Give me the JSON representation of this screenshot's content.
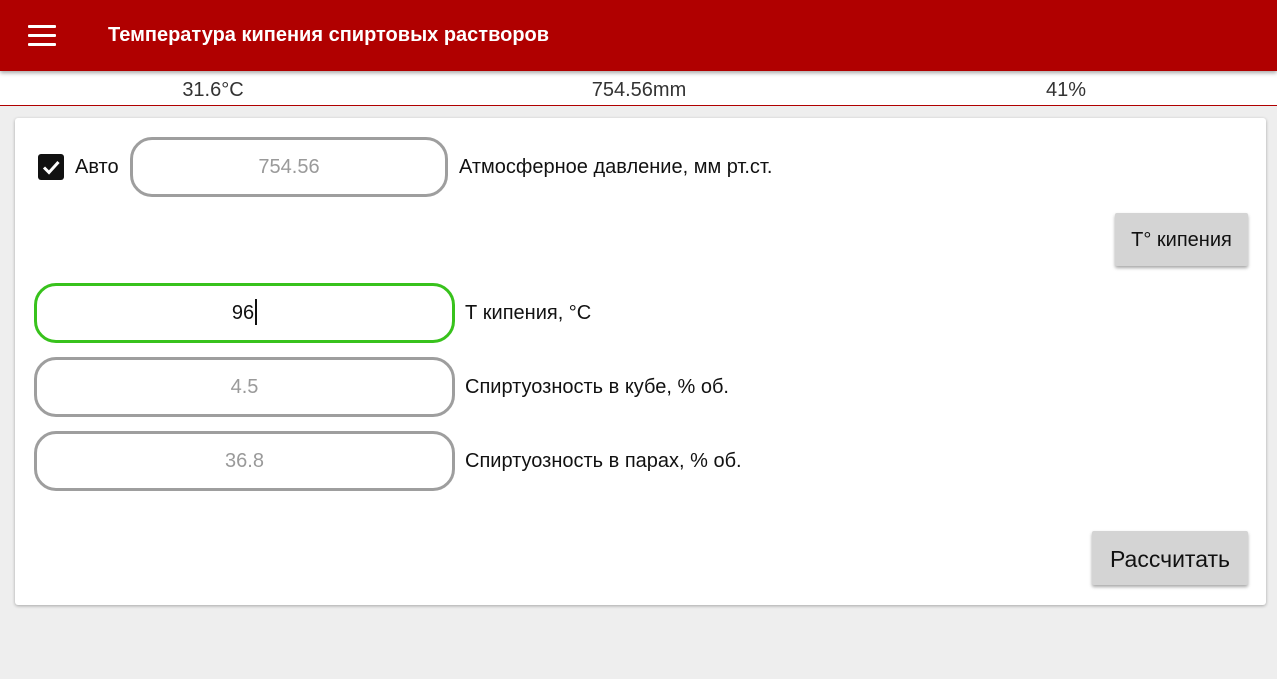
{
  "app_bar": {
    "title": "Температура кипения спиртовых растворов",
    "menu_icon": "hamburger-menu-icon",
    "color": "#b00000"
  },
  "status": {
    "temperature": "31.6°C",
    "pressure": "754.56mm",
    "humidity": "41%"
  },
  "form": {
    "auto_checkbox": {
      "checked": true,
      "label": "Авто"
    },
    "pressure": {
      "placeholder": "754.56",
      "label": "Атмосферное давление, мм рт.ст."
    },
    "boiling_button": "T° кипения",
    "boiling_temp": {
      "value": "96",
      "label": "Т кипения, °С",
      "focus_color": "#38c21c"
    },
    "cube_strength": {
      "placeholder": "4.5",
      "label": "Спиртуозность в кубе, % об."
    },
    "vapor_strength": {
      "placeholder": "36.8",
      "label": "Спиртуозность в парах, % об."
    },
    "calculate_button": "Рассчитать"
  }
}
